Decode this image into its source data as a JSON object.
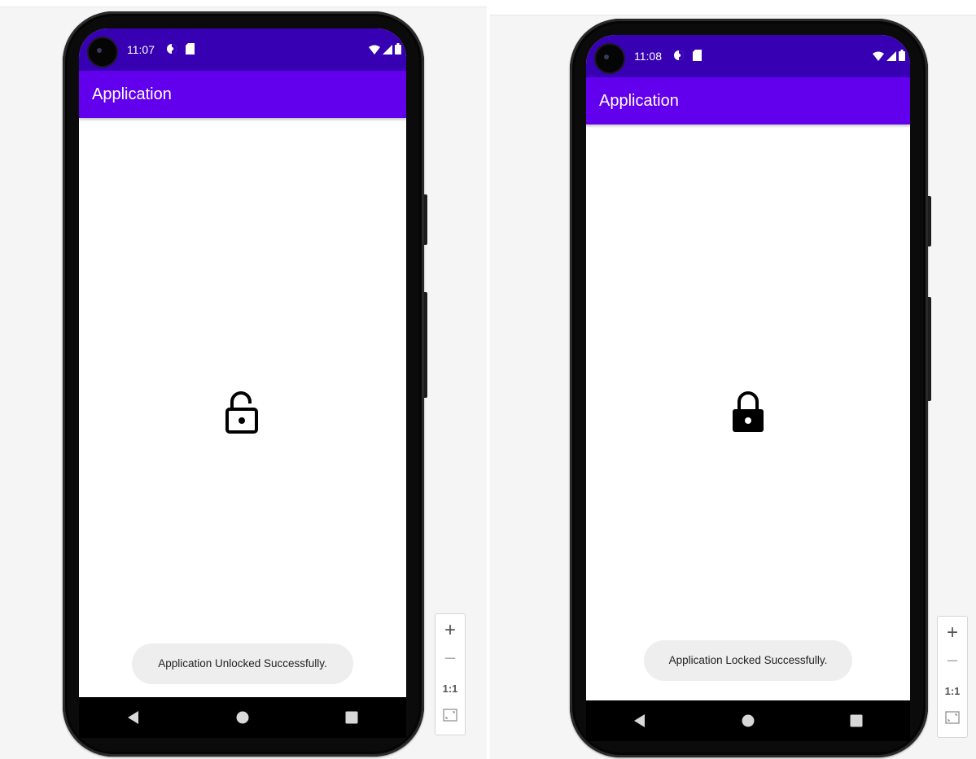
{
  "left": {
    "status": {
      "time": "11:07"
    },
    "app_bar": {
      "title": "Application"
    },
    "lock_state": "unlocked",
    "toast": "Application Unlocked Successfully."
  },
  "right": {
    "status": {
      "time": "11:08"
    },
    "app_bar": {
      "title": "Application"
    },
    "lock_state": "locked",
    "toast": "Application Locked Successfully."
  },
  "zoom_controls": {
    "zoom_in": "+",
    "zoom_out": "–",
    "actual_size": "1:1"
  },
  "colors": {
    "status_bar": "#3700b3",
    "app_bar": "#6200ee",
    "toast_bg": "#eeeeee"
  },
  "icons": {
    "left_lock": "lock-open-icon",
    "right_lock": "lock-icon",
    "nav": [
      "back-icon",
      "home-icon",
      "recents-icon"
    ]
  }
}
